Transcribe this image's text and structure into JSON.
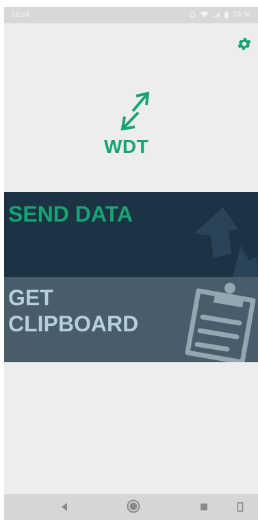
{
  "status_bar": {
    "time": "16:24",
    "battery": "75 %"
  },
  "toolbar": {
    "settings_icon": "gear-icon"
  },
  "logo": {
    "text": "WDT",
    "icon": "swap-arrows-icon",
    "color": "#17a374"
  },
  "actions": {
    "send_data_label": "SEND DATA",
    "send_data_icon": "upload-icon",
    "get_clipboard_label": "GET CLIPBOARD",
    "get_clipboard_icon": "clipboard-icon"
  },
  "navigation": {
    "back_icon": "back-icon",
    "home_icon": "home-icon",
    "recents_icon": "recents-icon",
    "rotate_icon": "rotate-icon"
  },
  "colors": {
    "accent": "#17a374",
    "send_panel": "#1c3344",
    "clipboard_panel": "#485d69",
    "clipboard_text": "#b7cde0"
  }
}
